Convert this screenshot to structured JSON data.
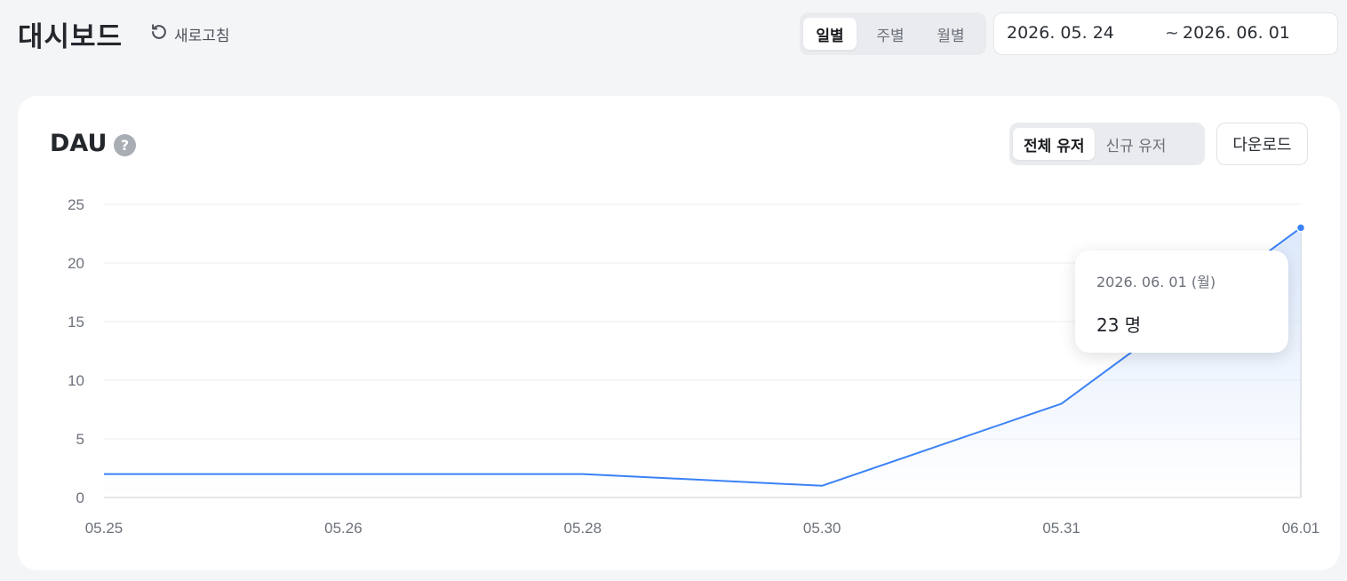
{
  "header": {
    "title": "대시보드",
    "refresh_label": "새로고침",
    "icon": "refresh-icon",
    "period_options": [
      {
        "label": "일별",
        "active": true
      },
      {
        "label": "주별",
        "active": false
      },
      {
        "label": "월별",
        "active": false
      }
    ],
    "date_range": {
      "start": "2026. 05. 24",
      "separator": "~",
      "end": "2026. 06. 01"
    }
  },
  "card": {
    "title": "DAU",
    "help_icon": "?",
    "user_types": [
      {
        "label": "전체 유저",
        "active": true
      },
      {
        "label": "신규 유저",
        "active": false
      }
    ],
    "download_label": "다운로드"
  },
  "tooltip": {
    "date": "2026. 06. 01 (월)",
    "value": "23 명"
  },
  "colors": {
    "line": "#3b82f6",
    "fill": "#dbe8fc",
    "background": "#f4f5f7"
  },
  "chart_data": {
    "type": "area",
    "x": [
      "05.25",
      "05.26",
      "05.28",
      "05.30",
      "05.31",
      "06.01"
    ],
    "y": [
      2,
      2,
      2,
      1,
      8,
      23
    ],
    "ylim": [
      0,
      25
    ],
    "yticks": [
      0,
      5,
      10,
      15,
      20,
      25
    ],
    "grid": true,
    "highlighted_point": "06.01"
  }
}
